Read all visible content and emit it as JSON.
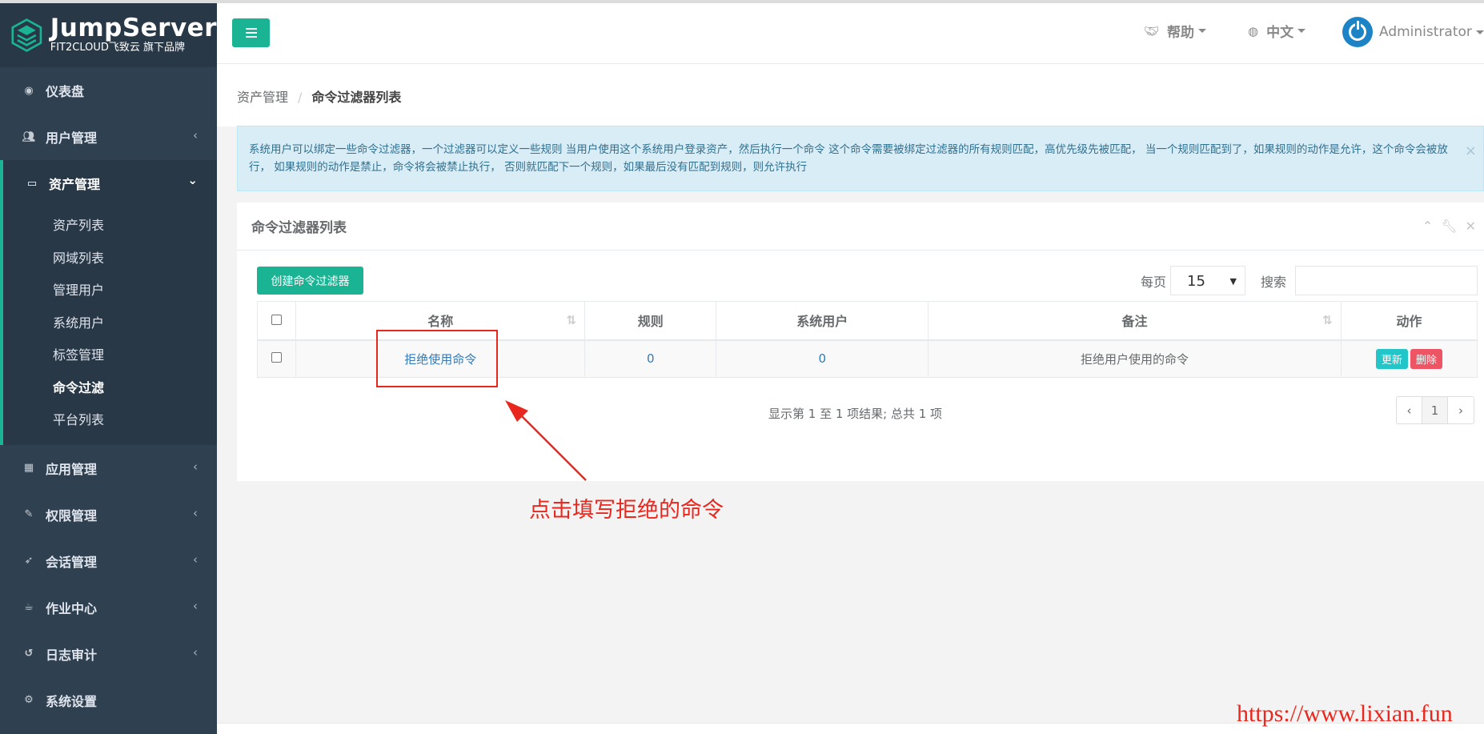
{
  "brand": {
    "name": "JumpServer",
    "tagline": "FIT2CLOUD飞致云 旗下品牌"
  },
  "sidebar": {
    "items": [
      {
        "label": "仪表盘",
        "icon": "dashboard-icon"
      },
      {
        "label": "用户管理",
        "icon": "users-icon"
      },
      {
        "label": "资产管理",
        "icon": "inbox-icon"
      },
      {
        "label": "应用管理",
        "icon": "grid-icon"
      },
      {
        "label": "权限管理",
        "icon": "edit-icon"
      },
      {
        "label": "会话管理",
        "icon": "rocket-icon"
      },
      {
        "label": "作业中心",
        "icon": "coffee-icon"
      },
      {
        "label": "日志审计",
        "icon": "history-icon"
      },
      {
        "label": "系统设置",
        "icon": "gears-icon"
      }
    ],
    "asset_sub": [
      "资产列表",
      "网域列表",
      "管理用户",
      "系统用户",
      "标签管理",
      "命令过滤",
      "平台列表"
    ],
    "active_sub": "命令过滤"
  },
  "topbar": {
    "help": "帮助",
    "language": "中文",
    "user": "Administrator"
  },
  "breadcrumb": {
    "parent": "资产管理",
    "separator": "/",
    "current": "命令过滤器列表"
  },
  "alert": {
    "text": "系统用户可以绑定一些命令过滤器，一个过滤器可以定义一些规则 当用户使用这个系统用户登录资产，然后执行一个命令 这个命令需要被绑定过滤器的所有规则匹配，高优先级先被匹配， 当一个规则匹配到了，如果规则的动作是允许，这个命令会被放行， 如果规则的动作是禁止，命令将会被禁止执行， 否则就匹配下一个规则，如果最后没有匹配到规则，则允许执行",
    "close": "×"
  },
  "panel": {
    "title": "命令过滤器列表",
    "create_label": "创建命令过滤器",
    "per_page_label": "每页",
    "per_page_value": "15",
    "search_label": "搜索",
    "search_value": "",
    "columns": [
      "名称",
      "规则",
      "系统用户",
      "备注",
      "动作"
    ],
    "rows": [
      {
        "name": "拒绝使用命令",
        "rules": "0",
        "system_users": "0",
        "comment": "拒绝用户使用的命令",
        "update": "更新",
        "delete": "删除"
      }
    ],
    "info": "显示第 1 至 1 项结果; 总共 1 项",
    "pagination": {
      "prev": "‹",
      "page": "1",
      "next": "›"
    }
  },
  "annotation": {
    "text": "点击填写拒绝的命令",
    "color": "#e8281e"
  },
  "watermark": "https://www.lixian.fun",
  "colors": {
    "sidebar": "#2f4050",
    "primary": "#1ab394",
    "info": "#23c6c8",
    "danger": "#ed5565",
    "link": "#337ab7"
  }
}
